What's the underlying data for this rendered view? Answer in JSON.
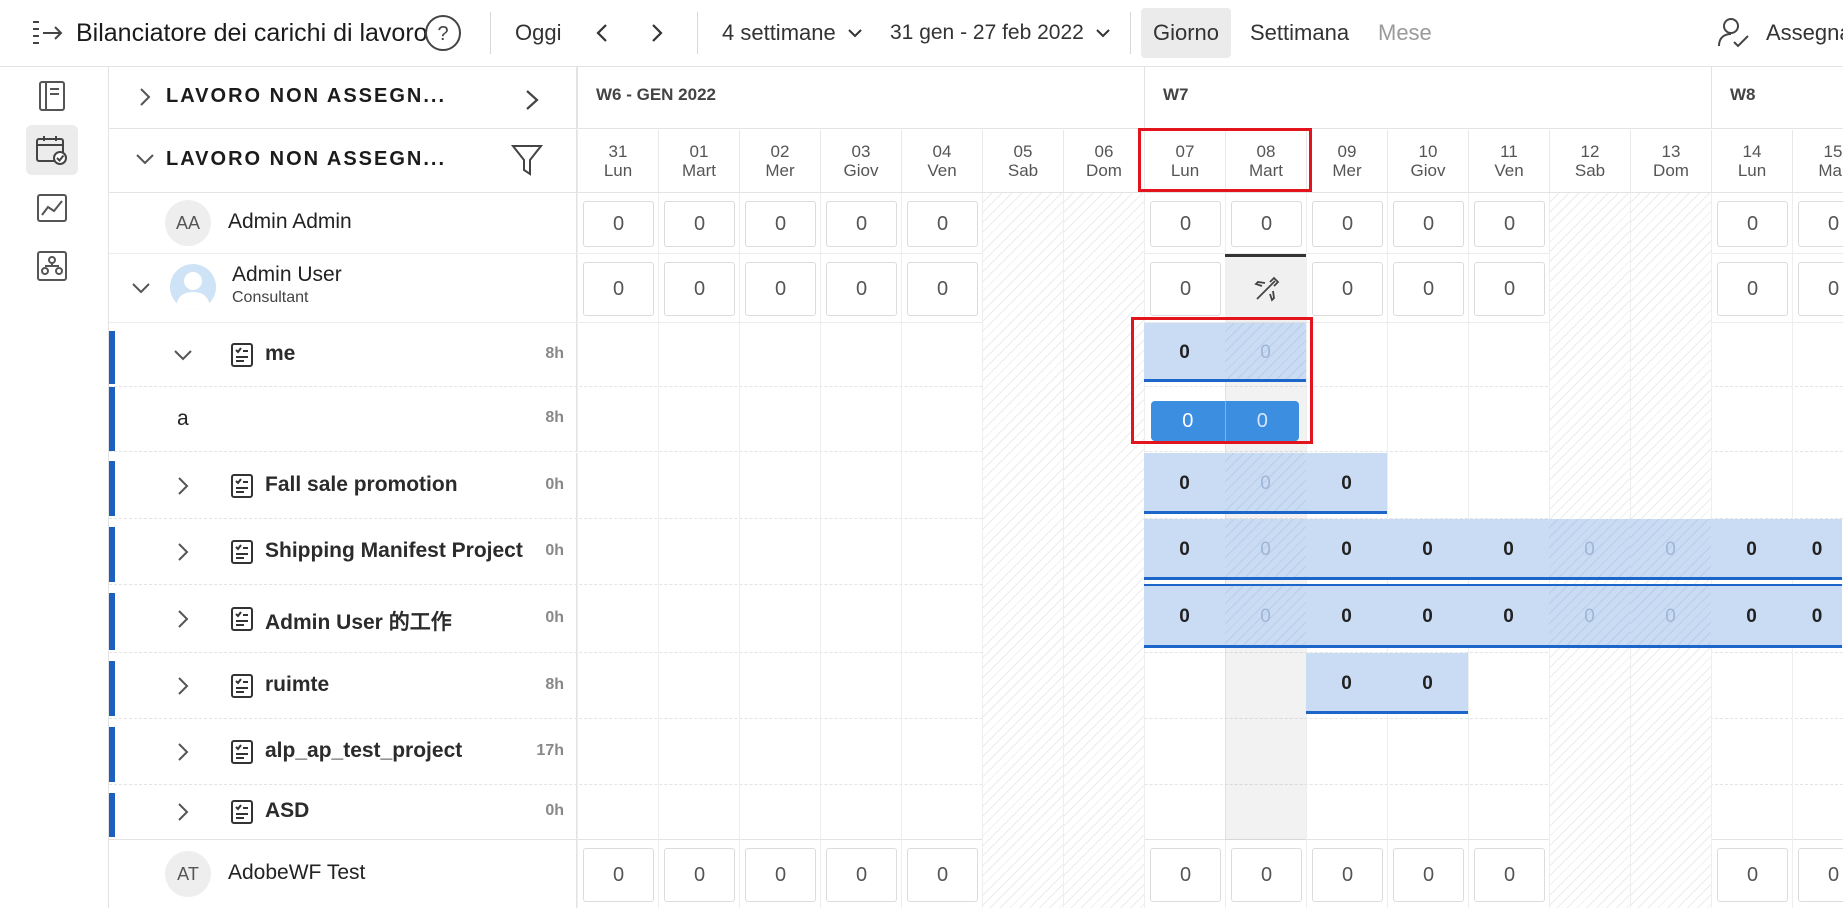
{
  "toolbar": {
    "title": "Bilanciatore dei carichi di lavoro",
    "today": "Oggi",
    "range_select": "4 settimane",
    "date_range": "31 gen - 27 feb 2022",
    "view_day": "Giorno",
    "view_week": "Settimana",
    "view_month": "Mese",
    "assign": "Assegna"
  },
  "sections": {
    "unassigned_collapsed": "LAVORO NON ASSEGN...",
    "unassigned_expanded": "LAVORO NON ASSEGN..."
  },
  "weeks": [
    "W6 - GEN 2022",
    "W7",
    "W8"
  ],
  "days": [
    {
      "num": "31",
      "name": "Lun"
    },
    {
      "num": "01",
      "name": "Mart"
    },
    {
      "num": "02",
      "name": "Mer"
    },
    {
      "num": "03",
      "name": "Giov"
    },
    {
      "num": "04",
      "name": "Ven"
    },
    {
      "num": "05",
      "name": "Sab"
    },
    {
      "num": "06",
      "name": "Dom"
    },
    {
      "num": "07",
      "name": "Lun"
    },
    {
      "num": "08",
      "name": "Mart"
    },
    {
      "num": "09",
      "name": "Mer"
    },
    {
      "num": "10",
      "name": "Giov"
    },
    {
      "num": "11",
      "name": "Ven"
    },
    {
      "num": "12",
      "name": "Sab"
    },
    {
      "num": "13",
      "name": "Dom"
    },
    {
      "num": "14",
      "name": "Lun"
    },
    {
      "num": "15",
      "name": "Mar"
    }
  ],
  "users": {
    "admin_admin": {
      "initials": "AA",
      "name": "Admin Admin"
    },
    "admin_user": {
      "name": "Admin User",
      "role": "Consultant"
    },
    "adobewf": {
      "initials": "AT",
      "name": "AdobeWF Test"
    }
  },
  "projects": [
    {
      "name": "me",
      "hours": "8h"
    },
    {
      "name": "a",
      "hours": "8h"
    },
    {
      "name": "Fall sale promotion",
      "hours": "0h"
    },
    {
      "name": "Shipping Manifest Project",
      "hours": "0h"
    },
    {
      "name": "Admin User 的工作",
      "hours": "0h"
    },
    {
      "name": "ruimte",
      "hours": "8h"
    },
    {
      "name": "alp_ap_test_project",
      "hours": "17h"
    },
    {
      "name": "ASD",
      "hours": "0h"
    }
  ],
  "zero": "0",
  "colors": {
    "accent": "#1d66c9",
    "alloc": "#c9dcf4",
    "highlight": "#e3141e"
  }
}
